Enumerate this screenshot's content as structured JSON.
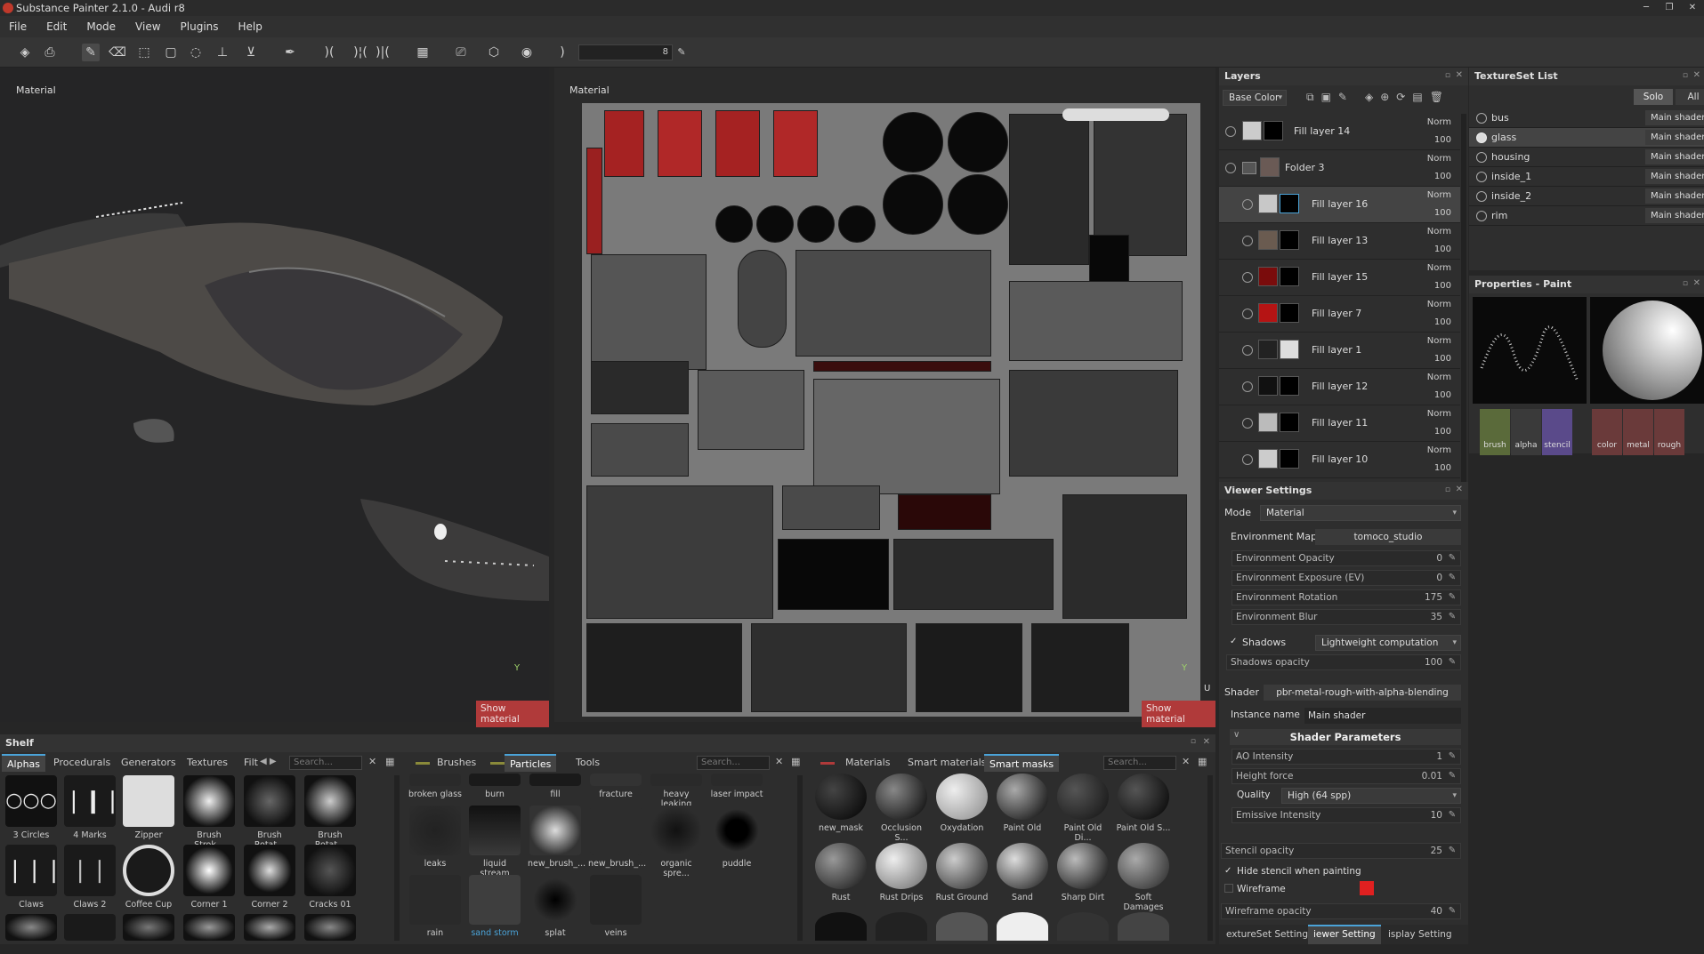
{
  "window": {
    "title": "Substance Painter 2.1.0 - Audi r8"
  },
  "menu": [
    "File",
    "Edit",
    "Mode",
    "View",
    "Plugins",
    "Help"
  ],
  "toolbar": {
    "brush_size": "8"
  },
  "viewport3d": {
    "label": "Material",
    "show_material": "Show material"
  },
  "viewport2d": {
    "label": "Material",
    "show_material": "Show material",
    "axis_y": "Y",
    "axis_u": "U"
  },
  "layers": {
    "title": "Layers",
    "channel": "Base Color",
    "rows": [
      {
        "name": "Fill layer 14",
        "blend": "Norm",
        "opacity": "100"
      },
      {
        "name": "Folder 3",
        "blend": "Norm",
        "opacity": "100"
      },
      {
        "name": "Fill layer 16",
        "blend": "Norm",
        "opacity": "100"
      },
      {
        "name": "Fill layer 13",
        "blend": "Norm",
        "opacity": "100"
      },
      {
        "name": "Fill layer 15",
        "blend": "Norm",
        "opacity": "100"
      },
      {
        "name": "Fill layer 7",
        "blend": "Norm",
        "opacity": "100"
      },
      {
        "name": "Fill layer 1",
        "blend": "Norm",
        "opacity": "100"
      },
      {
        "name": "Fill layer 12",
        "blend": "Norm",
        "opacity": "100"
      },
      {
        "name": "Fill layer 11",
        "blend": "Norm",
        "opacity": "100"
      },
      {
        "name": "Fill layer 10",
        "blend": "Norm",
        "opacity": "100"
      }
    ]
  },
  "viewer": {
    "title": "Viewer Settings",
    "mode_label": "Mode",
    "mode": "Material",
    "env_map_label": "Environment Map",
    "env_map": "tomoco_studio",
    "env_opacity_label": "Environment Opacity",
    "env_opacity": "0",
    "env_exposure_label": "Environment Exposure (EV)",
    "env_exposure": "0",
    "env_rotation_label": "Environment Rotation",
    "env_rotation": "175",
    "env_blur_label": "Environment Blur",
    "env_blur": "35",
    "shadows_label": "Shadows",
    "shadows": "Lightweight computation",
    "shadows_opacity_label": "Shadows opacity",
    "shadows_opacity": "100",
    "shader_label": "Shader",
    "shader": "pbr-metal-rough-with-alpha-blending",
    "instance_label": "Instance name",
    "instance": "Main shader",
    "shader_params": "Shader Parameters",
    "ao_label": "AO Intensity",
    "ao": "1",
    "height_label": "Height force",
    "height": "0.01",
    "quality_label": "Quality",
    "quality": "High (64 spp)",
    "emissive_label": "Emissive Intensity",
    "emissive": "10",
    "stencil_label": "Stencil opacity",
    "stencil": "25",
    "hide_stencil": "Hide stencil when painting",
    "wireframe_label": "Wireframe",
    "wireframe_opacity_label": "Wireframe opacity",
    "wireframe_opacity": "40",
    "bottom_tabs": [
      "extureSet Setting",
      "iewer Setting",
      "isplay Setting"
    ]
  },
  "textureset": {
    "title": "TextureSet List",
    "solo": "Solo",
    "all": "All",
    "rows": [
      {
        "name": "bus",
        "shader": "Main shader"
      },
      {
        "name": "glass",
        "shader": "Main shader"
      },
      {
        "name": "housing",
        "shader": "Main shader"
      },
      {
        "name": "inside_1",
        "shader": "Main shader"
      },
      {
        "name": "inside_2",
        "shader": "Main shader"
      },
      {
        "name": "rim",
        "shader": "Main shader"
      }
    ]
  },
  "properties": {
    "title": "Properties - Paint",
    "slots": [
      "brush",
      "alpha",
      "stencil",
      "color",
      "metal",
      "rough"
    ]
  },
  "shelf": {
    "title": "Shelf",
    "tabs1": [
      "Alphas",
      "Procedurals",
      "Generators",
      "Textures",
      "Filt"
    ],
    "search": "Search...",
    "alphas": [
      "3 Circles",
      "4 Marks",
      "Zipper",
      "Brush Strok...",
      "Brush Rotat...",
      "Brush Rotat...",
      "Claws",
      "Claws 2",
      "Coffee Cup",
      "Corner 1",
      "Corner 2",
      "Cracks 01"
    ],
    "tabs2": [
      "Brushes",
      "Particles",
      "Tools"
    ],
    "particles": [
      "broken glass",
      "burn",
      "fill",
      "fracture",
      "heavy leaking",
      "laser impact",
      "leaks",
      "liquid stream",
      "new_brush_...",
      "new_brush_...",
      "organic spre...",
      "puddle",
      "rain",
      "sand storm",
      "splat",
      "veins"
    ],
    "tabs3": [
      "Materials",
      "Smart materials",
      "Smart masks"
    ],
    "masks": [
      "new_mask",
      "Occlusion S...",
      "Oxydation",
      "Paint Old",
      "Paint Old Di...",
      "Paint Old S...",
      "Rust",
      "Rust Drips",
      "Rust Ground",
      "Sand",
      "Sharp Dirt",
      "Soft Damages"
    ]
  }
}
